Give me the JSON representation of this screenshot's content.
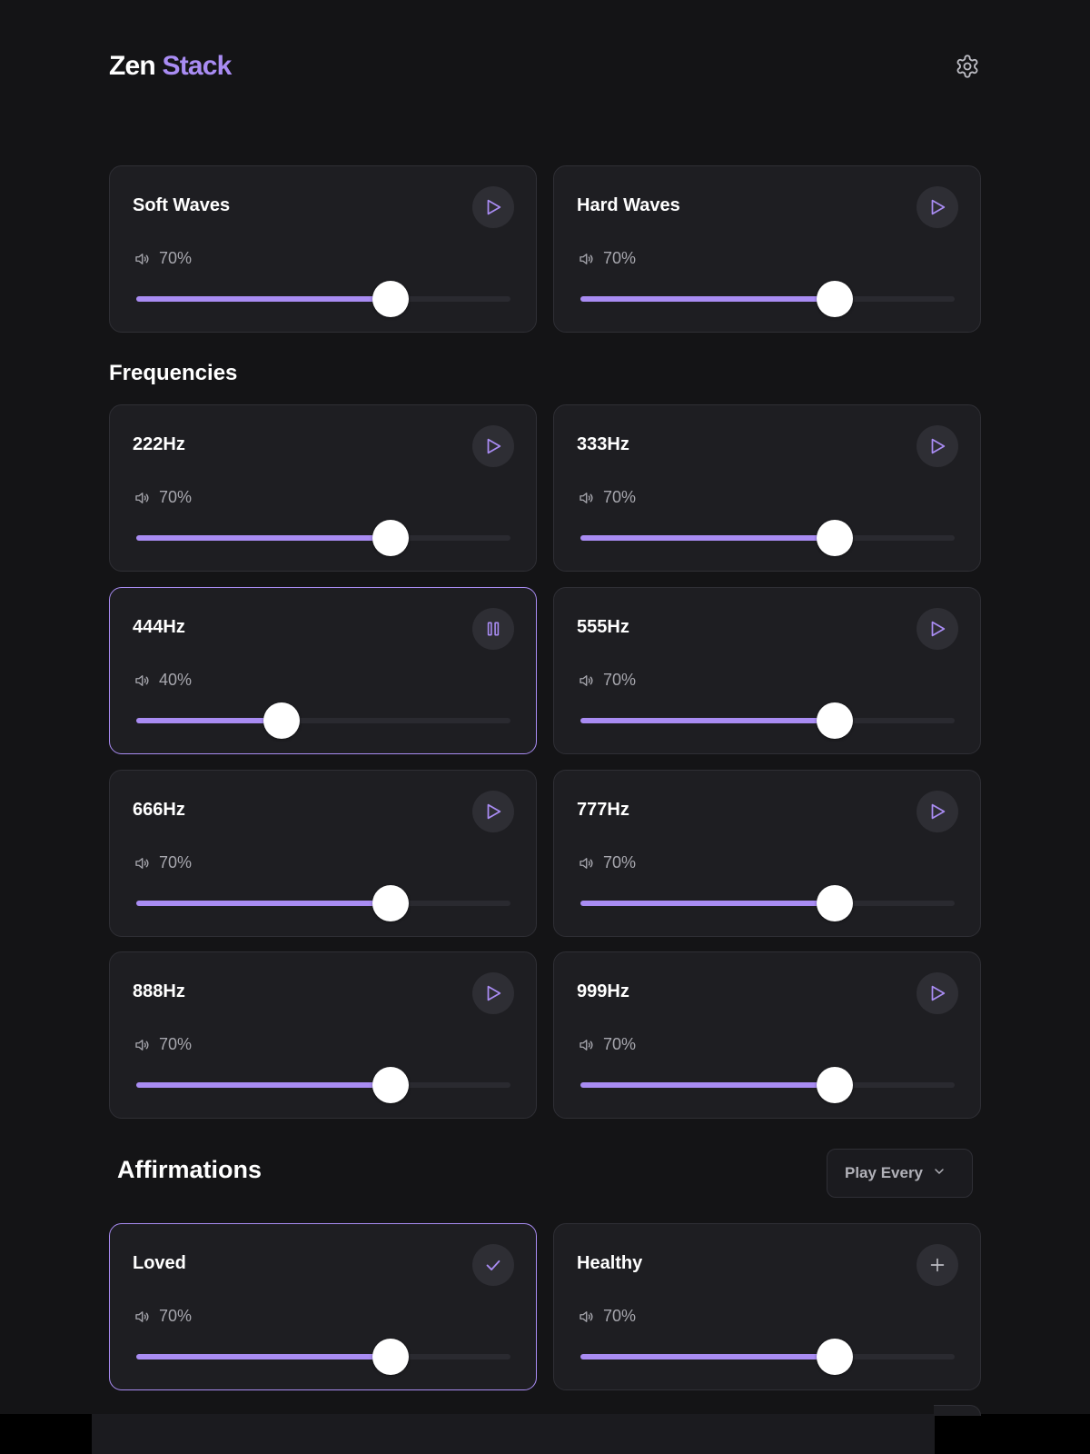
{
  "header": {
    "logo_part1": "Zen",
    "logo_part2": "Stack",
    "settings_icon": "gear-icon"
  },
  "colors": {
    "accent": "#a98cf3",
    "background": "#141416",
    "card": "#1e1e22"
  },
  "ambient": [
    {
      "name": "Soft Waves",
      "volume_label": "70%",
      "volume": 70,
      "state": "play"
    },
    {
      "name": "Hard Waves",
      "volume_label": "70%",
      "volume": 70,
      "state": "play"
    }
  ],
  "frequencies": {
    "title": "Frequencies",
    "items": [
      {
        "name": "222Hz",
        "volume_label": "70%",
        "volume": 70,
        "state": "play"
      },
      {
        "name": "333Hz",
        "volume_label": "70%",
        "volume": 70,
        "state": "play"
      },
      {
        "name": "444Hz",
        "volume_label": "40%",
        "volume": 40,
        "state": "pause"
      },
      {
        "name": "555Hz",
        "volume_label": "70%",
        "volume": 70,
        "state": "play"
      },
      {
        "name": "666Hz",
        "volume_label": "70%",
        "volume": 70,
        "state": "play"
      },
      {
        "name": "777Hz",
        "volume_label": "70%",
        "volume": 70,
        "state": "play"
      },
      {
        "name": "888Hz",
        "volume_label": "70%",
        "volume": 70,
        "state": "play"
      },
      {
        "name": "999Hz",
        "volume_label": "70%",
        "volume": 70,
        "state": "play"
      }
    ]
  },
  "affirmations": {
    "title": "Affirmations",
    "dropdown_label": "Play Every",
    "items": [
      {
        "name": "Loved",
        "volume_label": "70%",
        "volume": 70,
        "state": "selected"
      },
      {
        "name": "Healthy",
        "volume_label": "70%",
        "volume": 70,
        "state": "add"
      }
    ]
  }
}
